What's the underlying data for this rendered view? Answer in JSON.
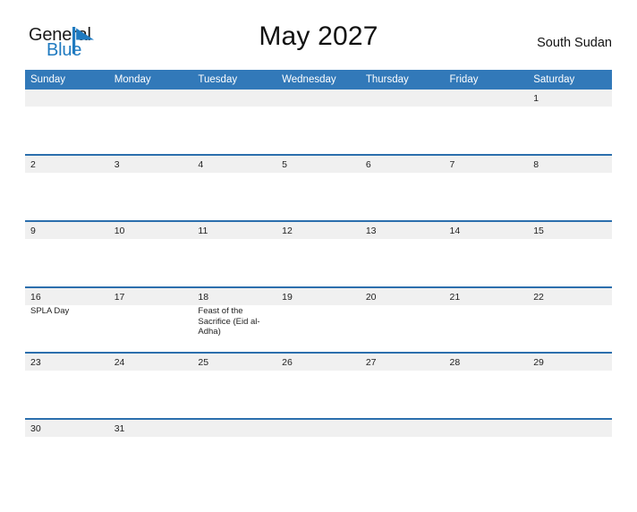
{
  "logo": {
    "word_one": "General",
    "word_two": "Blue",
    "mark": "flag-triangle-icon",
    "brand_blue": "#1f7ac0"
  },
  "header": {
    "title": "May 2027",
    "region": "South Sudan"
  },
  "colors": {
    "header_bar": "#3279b9",
    "week_rule": "#2c6fad",
    "day_band": "#f0f0f0",
    "text": "#222222"
  },
  "calendar": {
    "month": "May",
    "year": "2027",
    "weekday_headers": [
      "Sunday",
      "Monday",
      "Tuesday",
      "Wednesday",
      "Thursday",
      "Friday",
      "Saturday"
    ],
    "weeks": [
      {
        "days": [
          "",
          "",
          "",
          "",
          "",
          "",
          "1"
        ],
        "events": [
          "",
          "",
          "",
          "",
          "",
          "",
          ""
        ]
      },
      {
        "days": [
          "2",
          "3",
          "4",
          "5",
          "6",
          "7",
          "8"
        ],
        "events": [
          "",
          "",
          "",
          "",
          "",
          "",
          ""
        ]
      },
      {
        "days": [
          "9",
          "10",
          "11",
          "12",
          "13",
          "14",
          "15"
        ],
        "events": [
          "",
          "",
          "",
          "",
          "",
          "",
          ""
        ]
      },
      {
        "days": [
          "16",
          "17",
          "18",
          "19",
          "20",
          "21",
          "22"
        ],
        "events": [
          "SPLA Day",
          "",
          "Feast of the Sacrifice (Eid al-Adha)",
          "",
          "",
          "",
          ""
        ]
      },
      {
        "days": [
          "23",
          "24",
          "25",
          "26",
          "27",
          "28",
          "29"
        ],
        "events": [
          "",
          "",
          "",
          "",
          "",
          "",
          ""
        ]
      },
      {
        "days": [
          "30",
          "31",
          "",
          "",
          "",
          "",
          ""
        ],
        "events": [
          "",
          "",
          "",
          "",
          "",
          "",
          ""
        ]
      }
    ],
    "holidays": [
      {
        "date": "16",
        "name": "SPLA Day"
      },
      {
        "date": "18",
        "name": "Feast of the Sacrifice (Eid al-Adha)"
      }
    ]
  }
}
